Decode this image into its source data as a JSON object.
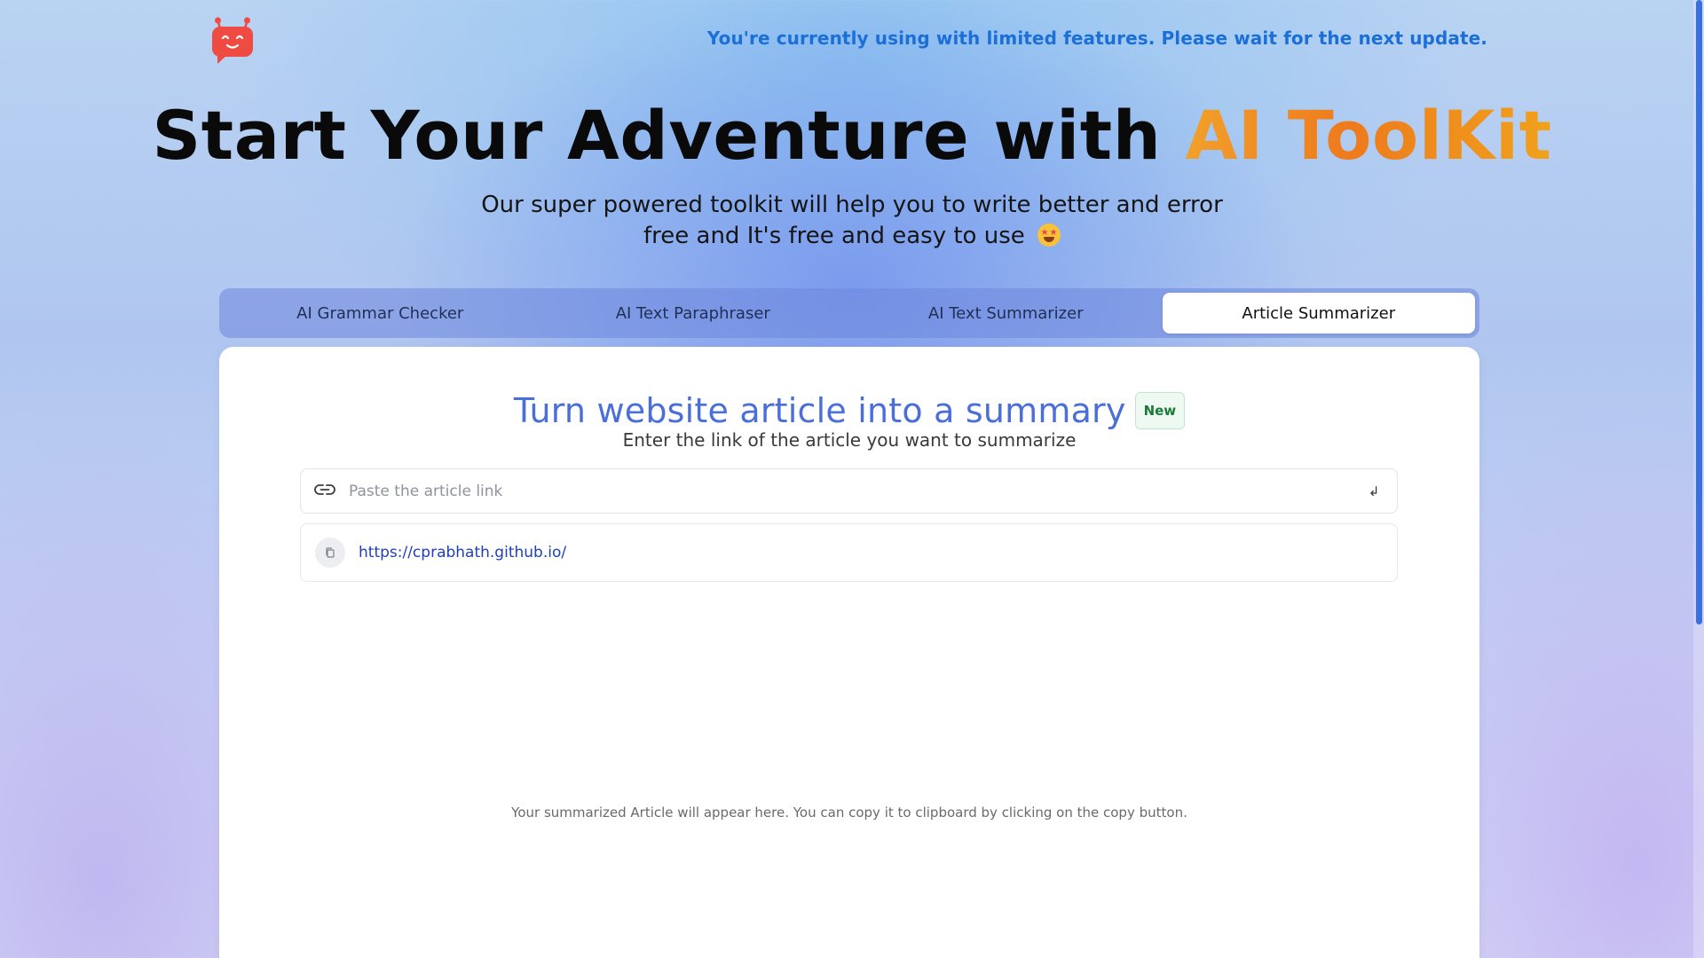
{
  "header": {
    "logo_icon": "robot-chat-icon",
    "notice": "You're currently using with limited features. Please wait for the next update."
  },
  "hero": {
    "title_prefix": "Start Your Adventure with",
    "title_accent": "AI ToolKit",
    "subtitle_line1": "Our super powered toolkit will help you to write better and error",
    "subtitle_line2": "free and It's free and easy to use",
    "subtitle_emoji": "star-struck-emoji"
  },
  "tabs": [
    {
      "label": "AI Grammar Checker",
      "active": false
    },
    {
      "label": "AI Text Paraphraser",
      "active": false
    },
    {
      "label": "AI Text Summarizer",
      "active": false
    },
    {
      "label": "Article Summarizer",
      "active": true
    }
  ],
  "card": {
    "title": "Turn website article into a summary",
    "badge": "New",
    "subtitle": "Enter the link of the article you want to summarize",
    "input": {
      "placeholder": "Paste the article link",
      "value": "",
      "leading_icon": "link-icon",
      "submit_icon": "enter-icon",
      "submit_glyph": "↲"
    },
    "history": [
      {
        "url": "https://cprabhath.github.io/",
        "icon": "copy-icon"
      }
    ],
    "output_placeholder": "Your summarized Article will appear here. You can copy it to clipboard by clicking on the copy button."
  },
  "colors": {
    "accent_blue": "#4b6fd9",
    "accent_orange": "#ee7a1d",
    "notice_blue": "#1b6fd6",
    "logo_red": "#ef4b42",
    "badge_green": "#1c7a38"
  }
}
